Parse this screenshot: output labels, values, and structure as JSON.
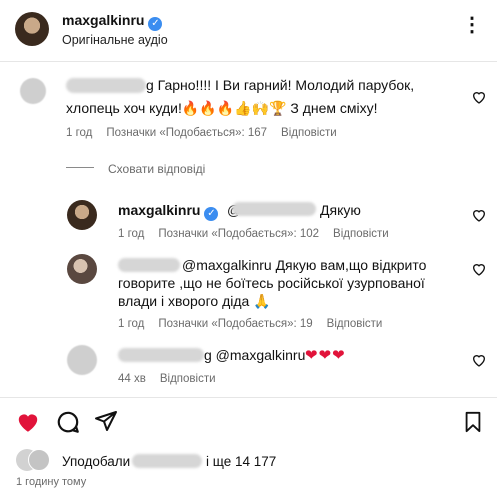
{
  "post": {
    "username": "maxgalkinru",
    "audio": "Оригінальне аудіо",
    "more": "⋮"
  },
  "comments": [
    {
      "text_line1": "g Гарно!!!! І Ви гарний! Молодий парубок,",
      "text_line2": "хлопець хоч куди!🔥🔥🔥👍🙌🏆 З днем сміху!",
      "time": "1 год",
      "likes": "Позначки «Подобається»: 167",
      "reply": "Відповісти"
    }
  ],
  "hide_replies": "Сховати відповіді",
  "replies": [
    {
      "username": "maxgalkinru",
      "text": "Дякую",
      "mention_prefix": "@",
      "time": "1 год",
      "likes": "Позначки «Подобається»: 102",
      "reply": "Відповісти"
    },
    {
      "text_line1": "@maxgalkinru Дякую вам,що відкрито",
      "text_line2": "говорите ,що не боїтесь російської узурпованої",
      "text_line3": "влади і хворого діда 🙏",
      "time": "1 год",
      "likes": "Позначки «Подобається»: 19",
      "reply": "Відповісти"
    },
    {
      "text": "g @maxgalkinru",
      "hearts": "❤❤❤",
      "time": "44 хв",
      "reply": "Відповісти"
    }
  ],
  "actions": {
    "like_icon": "heart-filled-icon",
    "comment_icon": "comment-icon",
    "share_icon": "send-icon",
    "save_icon": "bookmark-icon"
  },
  "liked_by": {
    "prefix": "Уподобали",
    "suffix": "і ще 14 177"
  },
  "footer_time": "1 годину тому",
  "colors": {
    "heart": "#e1133a",
    "verified": "#3b8df0",
    "muted": "#6b6b6b"
  }
}
